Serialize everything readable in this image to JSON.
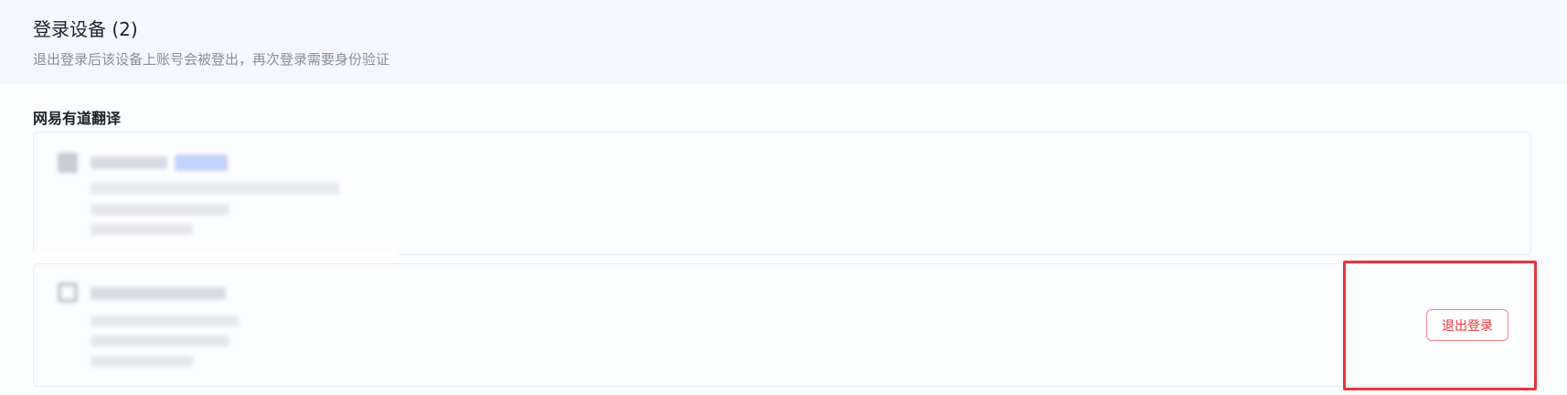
{
  "page": {
    "title": "登录设备 (2)",
    "subtitle": "退出登录后该设备上账号会被登出，再次登录需要身份验证"
  },
  "sections": [
    {
      "name": "网易有道翻译",
      "devices": [
        {
          "name_hidden": true,
          "badge": "",
          "actions": []
        },
        {
          "name_hidden": true,
          "actions": [
            "退出登录"
          ]
        }
      ]
    }
  ],
  "colors": {
    "accent": "#e8353c",
    "header_bg": "#f5f7fc",
    "title": "#1d2129",
    "muted": "#86909c"
  },
  "icons": {
    "device_1": "device-icon",
    "device_2": "device-icon"
  }
}
